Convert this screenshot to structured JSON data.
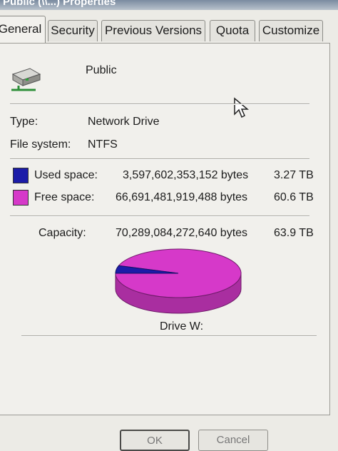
{
  "window": {
    "title": "Public (\\\\...) Properties"
  },
  "tabs": [
    {
      "label": "General"
    },
    {
      "label": "Security"
    },
    {
      "label": "Previous Versions"
    },
    {
      "label": "Quota"
    },
    {
      "label": "Customize"
    }
  ],
  "drive": {
    "name": "Public",
    "icon": "network-drive-icon"
  },
  "details": {
    "type_label": "Type:",
    "type_value": "Network Drive",
    "fs_label": "File system:",
    "fs_value": "NTFS"
  },
  "usage": {
    "used_label": "Used space:",
    "used_bytes": "3,597,602,353,152 bytes",
    "used_size": "3.27 TB",
    "used_color": "#1c1ca8",
    "free_label": "Free space:",
    "free_bytes": "66,691,481,919,488 bytes",
    "free_size": "60.6 TB",
    "free_color": "#d639c9"
  },
  "capacity": {
    "label": "Capacity:",
    "bytes": "70,289,084,272,640 bytes",
    "size": "63.9 TB"
  },
  "chart_data": {
    "type": "pie",
    "categories": [
      "Used space",
      "Free space"
    ],
    "values": [
      3597602353152,
      66691481919488
    ],
    "colors": [
      "#1c1ca8",
      "#d639c9"
    ],
    "title": "Drive W:"
  },
  "buttons": {
    "ok": "OK",
    "cancel": "Cancel"
  }
}
